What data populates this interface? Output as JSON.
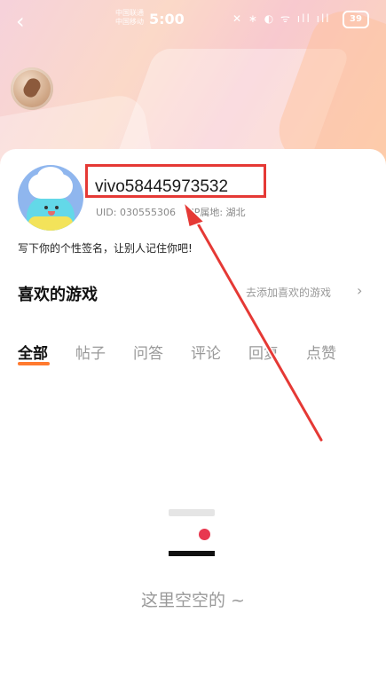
{
  "status_bar": {
    "carrier_1": "中国联通",
    "carrier_2": "中国移动",
    "time": "5:00",
    "icons_text": "✕ ∗ ◐ ᯤ ıll ıll",
    "battery": "39"
  },
  "profile": {
    "username": "vivo58445973532",
    "uid_label": "UID: 030555306",
    "location_label": "IP属地: 湖北",
    "signature": "写下你的个性签名，让别人记住你吧!"
  },
  "favorite_games": {
    "title": "喜欢的游戏",
    "add_label": "去添加喜欢的游戏",
    "chevron": "›"
  },
  "tabs": [
    {
      "label": "全部"
    },
    {
      "label": "帖子"
    },
    {
      "label": "问答"
    },
    {
      "label": "评论"
    },
    {
      "label": "回复"
    },
    {
      "label": "点赞"
    }
  ],
  "empty_state": {
    "text": "这里空空的 ~"
  },
  "colors": {
    "accent_orange": "#ff7a2f",
    "annotation_red": "#e53935",
    "empty_dot": "#e8384f"
  },
  "icons": {
    "back": "chevron-left-icon",
    "header_badge": "cookie-icon",
    "empty": "empty-box-icon"
  }
}
